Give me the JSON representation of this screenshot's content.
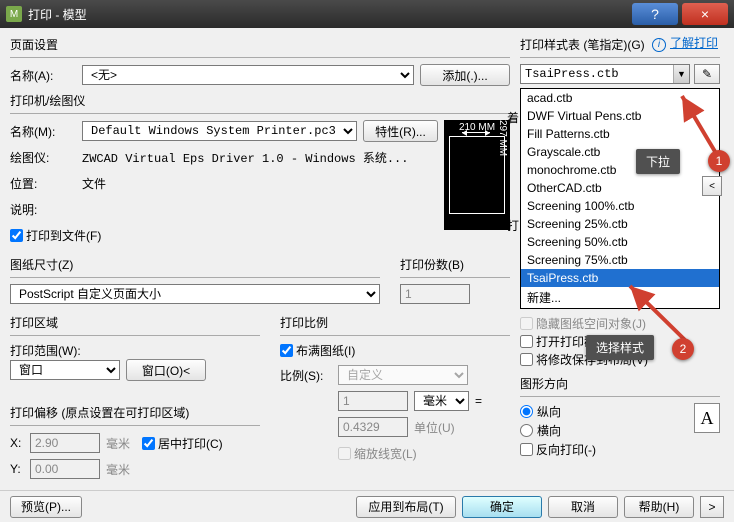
{
  "titlebar": {
    "logo_text": "M",
    "title": "打印 - 模型",
    "help": "?",
    "close": "×"
  },
  "learn": {
    "info": "i",
    "text": "了解打印"
  },
  "page_setup": {
    "legend": "页面设置",
    "name_label": "名称(A):",
    "name_value": "<无>",
    "add_btn": "添加(.)..."
  },
  "printer": {
    "legend": "打印机/绘图仪",
    "name_label": "名称(M):",
    "name_value": "Default Windows System Printer.pc3",
    "props_btn": "特性(R)...",
    "plotter_label": "绘图仪:",
    "plotter_value": "ZWCAD Virtual Eps Driver 1.0 - Windows 系统...",
    "location_label": "位置:",
    "location_value": "文件",
    "desc_label": "说明:",
    "to_file": "打印到文件(F)",
    "preview_w": "210 MM",
    "preview_h": "297 MM"
  },
  "paper": {
    "legend": "图纸尺寸(Z)",
    "value": "PostScript 自定义页面大小",
    "copies_legend": "打印份数(B)",
    "copies": "1"
  },
  "area": {
    "legend": "打印区域",
    "scope_label": "打印范围(W):",
    "scope_value": "窗口",
    "window_btn": "窗口(O)<"
  },
  "scale": {
    "legend": "打印比例",
    "fit": "布满图纸(I)",
    "ratio_label": "比例(S):",
    "ratio_value": "自定义",
    "num": "1",
    "unit": "毫米",
    "den": "0.4329",
    "unit_label": "单位(U)",
    "lineweight": "缩放线宽(L)"
  },
  "offset": {
    "legend": "打印偏移 (原点设置在可打印区域)",
    "x_label": "X:",
    "x_value": "2.90",
    "x_unit": "毫米",
    "y_label": "Y:",
    "y_value": "0.00",
    "y_unit": "毫米",
    "center": "居中打印(C)"
  },
  "style_table": {
    "legend": "打印样式表 (笔指定)(G)",
    "current": "TsaiPress.ctb",
    "items": [
      "acad.ctb",
      "DWF Virtual Pens.ctb",
      "Fill Patterns.ctb",
      "Grayscale.ctb",
      "monochrome.ctb",
      "OtherCAD.ctb",
      "Screening 100%.ctb",
      "Screening 25%.ctb",
      "Screening 50%.ctb",
      "Screening 75%.ctb",
      "TsaiPress.ctb",
      "新建..."
    ],
    "shaded_prefix1": "着",
    "shaded_prefix2": "打",
    "pencil": "✎"
  },
  "options": {
    "hide": "隐藏图纸空间对象(J)",
    "stamp": "打开打印戳记(N)",
    "save_layout": "将修改保存到布局(V)"
  },
  "orient": {
    "legend": "图形方向",
    "portrait": "纵向",
    "landscape": "横向",
    "reverse": "反向打印(-)",
    "letter": "A"
  },
  "buttons": {
    "preview": "预览(P)...",
    "apply": "应用到布局(T)",
    "ok": "确定",
    "cancel": "取消",
    "help": "帮助(H)",
    "expand": ">"
  },
  "annotations": {
    "callout1": "下拉",
    "badge1": "1",
    "callout2": "选择样式",
    "badge2": "2"
  }
}
